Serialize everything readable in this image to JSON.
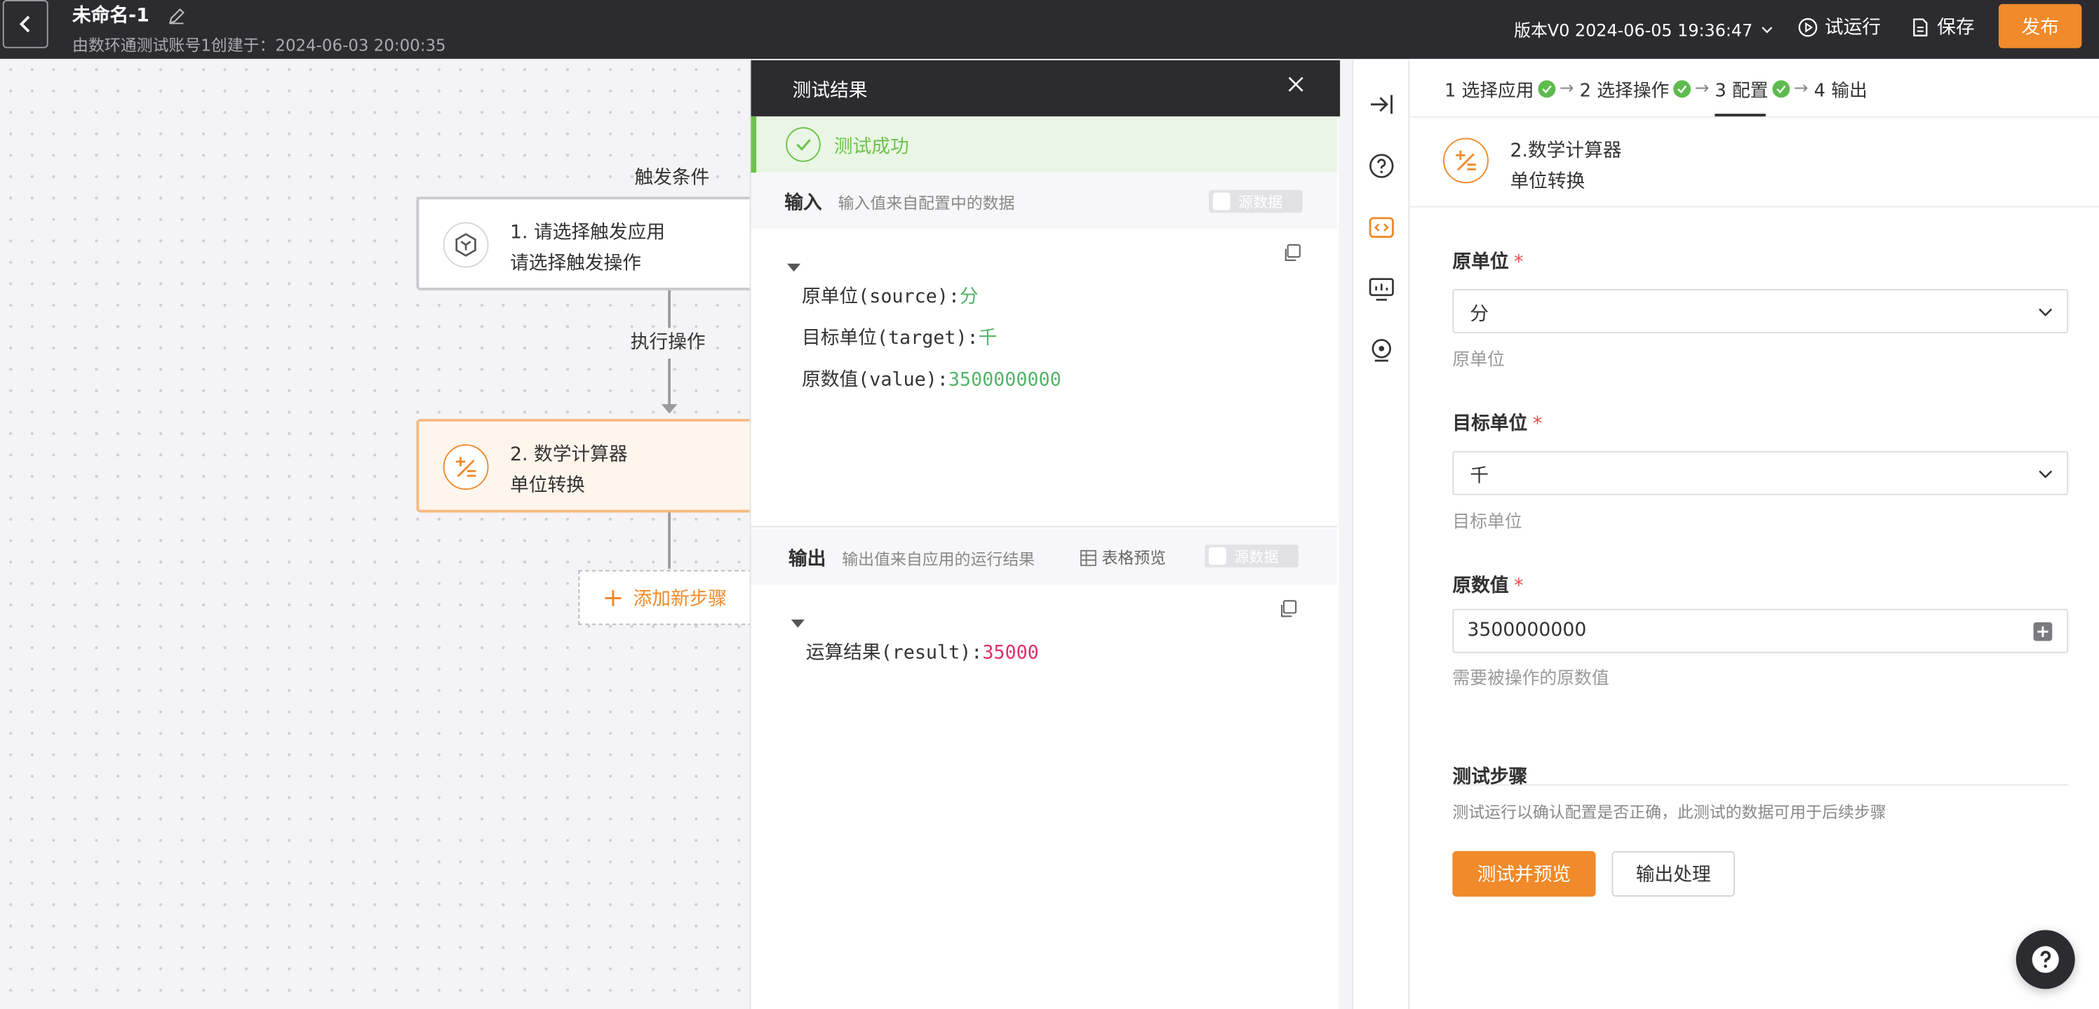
{
  "header": {
    "title": "未命名-1",
    "subtitle": "由数环通测试账号1创建于：2024-06-03 20:00:35",
    "version": "版本V0 2024-06-05 19:36:47",
    "trial_run": "试运行",
    "save": "保存",
    "publish": "发布"
  },
  "canvas": {
    "trigger_label": "触发条件",
    "trigger_node": {
      "line1": "1. 请选择触发应用",
      "line2": "请选择触发操作"
    },
    "action_label": "执行操作",
    "action_node": {
      "line1": "2. 数学计算器",
      "line2": "单位转换"
    },
    "add_step": "添加新步骤"
  },
  "test_panel": {
    "title": "测试结果",
    "status": "测试成功",
    "input": {
      "title": "输入",
      "desc": "输入值来自配置中的数据",
      "toggle": "源数据",
      "fields": [
        {
          "key": "原单位(source):",
          "value": "分"
        },
        {
          "key": "目标单位(target):",
          "value": "千"
        },
        {
          "key": "原数值(value):",
          "value": "3500000000"
        }
      ]
    },
    "output": {
      "title": "输出",
      "desc": "输出值来自应用的运行结果",
      "table_preview": "表格预览",
      "toggle": "源数据",
      "fields": [
        {
          "key": "运算结果(result):",
          "value": "35000"
        }
      ]
    }
  },
  "steps": [
    {
      "label": "1 选择应用",
      "done": true
    },
    {
      "label": "2 选择操作",
      "done": true
    },
    {
      "label": "3 配置",
      "done": true
    },
    {
      "label": "4 输出",
      "done": false
    }
  ],
  "config": {
    "node_line1": "2.数学计算器",
    "node_line2": "单位转换",
    "fields": [
      {
        "label": "原单位",
        "value": "分",
        "hint": "原单位"
      },
      {
        "label": "目标单位",
        "value": "千",
        "hint": "目标单位"
      },
      {
        "label": "原数值",
        "value": "3500000000",
        "hint": "需要被操作的原数值"
      }
    ],
    "required_mark": "*",
    "test_title": "测试步骤",
    "test_desc": "测试运行以确认配置是否正确，此测试的数据可用于后续步骤",
    "test_button": "测试并预览",
    "output_button": "输出处理"
  },
  "colors": {
    "accent": "#f08a2a",
    "success": "#6cc24a",
    "dark": "#2c2c30"
  }
}
